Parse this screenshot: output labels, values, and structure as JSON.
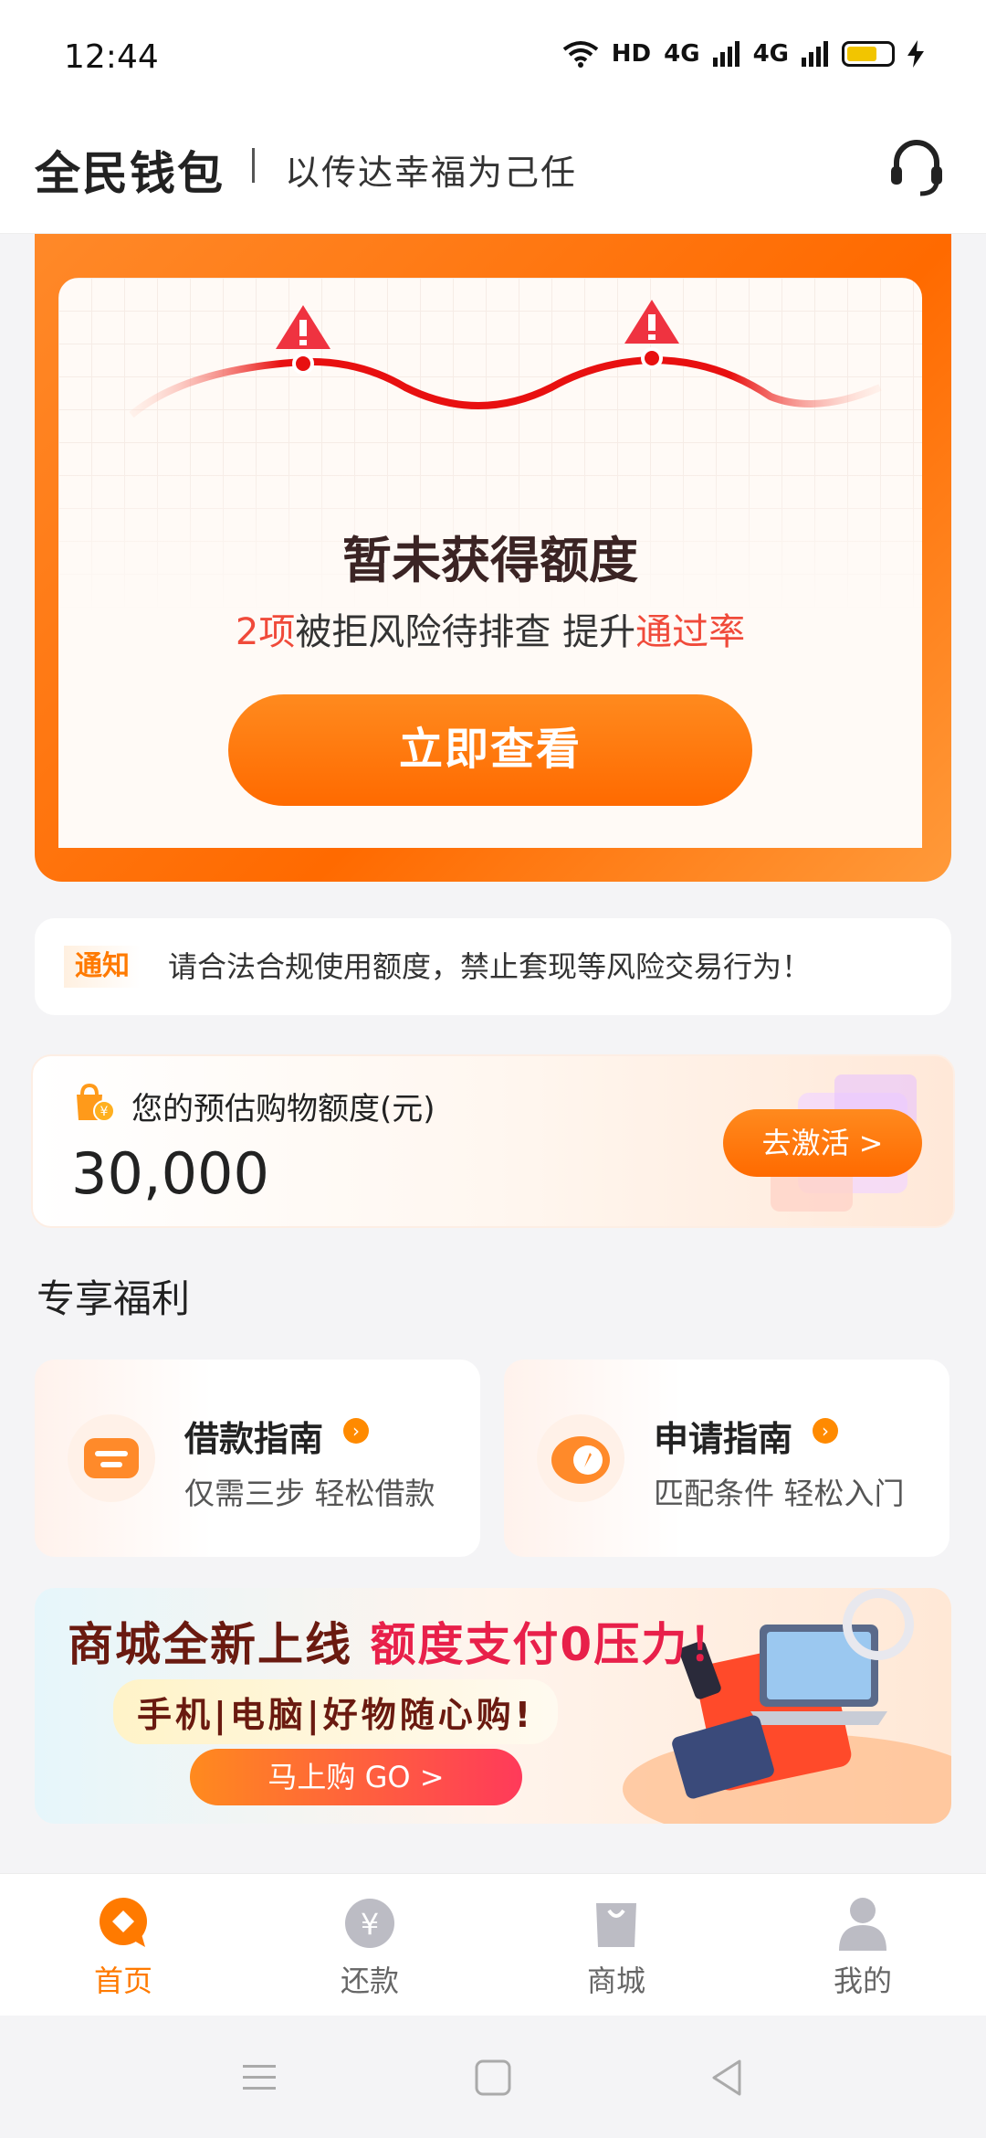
{
  "status": {
    "time": "12:44",
    "network": "HD",
    "signal1": "4G",
    "signal2": "4G"
  },
  "header": {
    "app_name": "全民钱包",
    "slogan": "以传达幸福为己任"
  },
  "hero": {
    "title": "暂未获得额度",
    "sub_count": "2项",
    "sub_mid": "被拒风险待排查 提升",
    "sub_end": "通过率",
    "button": "立即查看"
  },
  "notice": {
    "tag": "通知",
    "text": "请合法合规使用额度，禁止套现等风险交易行为！"
  },
  "quota": {
    "label": "您的预估购物额度(元)",
    "amount": "30,000",
    "button": "去激活 >"
  },
  "benefits": {
    "title": "专享福利",
    "items": [
      {
        "title": "借款指南",
        "sub": "仅需三步 轻松借款"
      },
      {
        "title": "申请指南",
        "sub": "匹配条件 轻松入门"
      }
    ]
  },
  "banner": {
    "title_a": "商城全新上线 ",
    "title_b": "额度支付0压力！",
    "sub": "手机|电脑|好物随心购!",
    "button": "马上购  GO >"
  },
  "tabs": [
    {
      "label": "首页",
      "active": true
    },
    {
      "label": "还款",
      "active": false
    },
    {
      "label": "商城",
      "active": false
    },
    {
      "label": "我的",
      "active": false
    }
  ],
  "colors": {
    "accent": "#ff7a00",
    "highlight": "#f04a3a"
  }
}
